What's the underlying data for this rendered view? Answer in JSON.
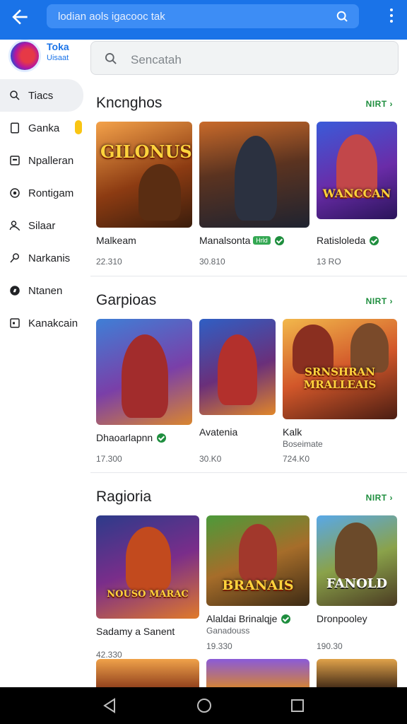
{
  "topbar": {
    "url_text": "lodian aols igacooc tak"
  },
  "brand": {
    "name_line1": "Toka",
    "name_line2": "Uisaat"
  },
  "search": {
    "placeholder": "Sencatah"
  },
  "sidebar": {
    "items": [
      {
        "label": "Tiacs",
        "icon": "search-icon"
      },
      {
        "label": "Ganka",
        "icon": "tablet-icon"
      },
      {
        "label": "Npalleran",
        "icon": "window-icon"
      },
      {
        "label": "Rontigam",
        "icon": "record-icon"
      },
      {
        "label": "Silaar",
        "icon": "person-icon"
      },
      {
        "label": "Narkanis",
        "icon": "pin-icon"
      },
      {
        "label": "Ntanen",
        "icon": "compass-icon"
      },
      {
        "label": "Kanakcain",
        "icon": "box-icon"
      }
    ]
  },
  "sections": [
    {
      "title": "Kncnghos",
      "more": "NIRT",
      "cards": [
        {
          "art_title": "GILONUS",
          "name": "Malkeam",
          "downloads": "22.310"
        },
        {
          "art_title": "",
          "name": "Manalsonta",
          "tag": "Hrld",
          "downloads": "30.810"
        },
        {
          "art_title": "WANCCAN",
          "name": "Ratisloleda",
          "downloads": "13 RO"
        }
      ]
    },
    {
      "title": "Garpioas",
      "more": "NIRT",
      "cards": [
        {
          "art_title": "",
          "name": "Dhaoarlapnn",
          "downloads": "17.300"
        },
        {
          "art_title": "",
          "name": "Avatenia",
          "downloads": "30.K0"
        },
        {
          "art_title": "SRNSHRAN MRALLEAIS",
          "name": "Kalk",
          "sub": "Boseimate",
          "downloads": "724.K0"
        }
      ]
    },
    {
      "title": "Ragioria",
      "more": "NIRT",
      "cards": [
        {
          "art_title": "NOUSO MARAC",
          "name": "Sadamy a Sanent",
          "downloads": "42.330"
        },
        {
          "art_title": "BRANAIS",
          "name": "Alaldai Brinalqje",
          "sub": "Ganadouss",
          "downloads": "19.330"
        },
        {
          "art_title": "FANOLD",
          "name": "Dronpooley",
          "downloads": "190.30"
        }
      ]
    }
  ],
  "colors": {
    "accent": "#1a73e8",
    "verified": "#1e8e3e",
    "badge": "#f9c513"
  }
}
